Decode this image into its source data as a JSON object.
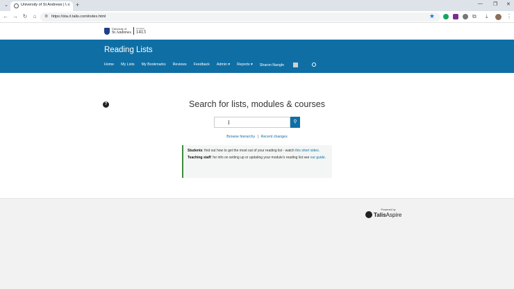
{
  "browser": {
    "tab_title": "University of St Andrews | Univ...",
    "url": "https://sta.rl.talis.com/index.html",
    "new_tab_symbol": "+",
    "tab_close_symbol": "×"
  },
  "site_logo": {
    "line1": "University of",
    "line2": "St Andrews",
    "founded_label": "FOUNDED",
    "year": "1413"
  },
  "banner": {
    "title": "Reading Lists",
    "nav": [
      "Home",
      "My Lists",
      "My Bookmarks",
      "Reviews",
      "Feedback",
      "Admin ▾",
      "Reports ▾",
      "Sharon Nangle"
    ]
  },
  "main": {
    "help_symbol": "?",
    "heading": "Search for lists, modules & courses",
    "search_placeholder": "",
    "links": {
      "browse": "Browse hierarchy",
      "separator": "|",
      "recent": "Recent changes"
    },
    "info": {
      "students_label": "Students",
      "students_text": ": find out how to get the most out of your reading list - watch ",
      "students_link": "this short video",
      "students_end": ".",
      "staff_label": "Teaching staff",
      "staff_text": ": for info on setting up or updating your module's reading list see ",
      "staff_link": "our guide",
      "staff_end": "."
    }
  },
  "footer": {
    "powered_by": "Powered by",
    "brand_a": "Talis",
    "brand_b": "Aspire"
  }
}
